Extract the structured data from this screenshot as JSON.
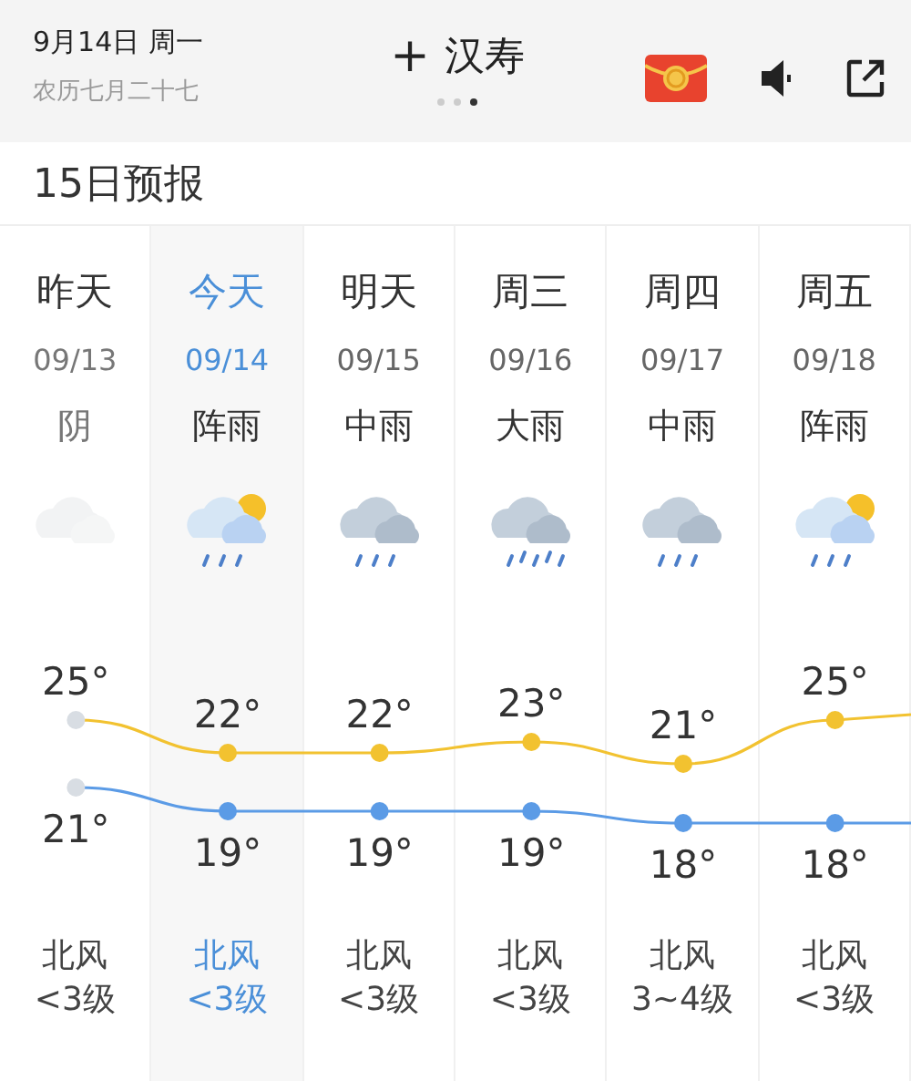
{
  "header": {
    "date": "9月14日 周一",
    "lunar": "农历七月二十七",
    "add_symbol": "+",
    "city": "汉寿",
    "pages": [
      {
        "selected": false
      },
      {
        "selected": false
      },
      {
        "selected": true
      }
    ]
  },
  "section_title": "15日预报",
  "days": [
    {
      "name": "昨天",
      "date": "09/13",
      "condition": "阴",
      "kind": "cloudy",
      "past": true,
      "selected": false,
      "high": "25°",
      "low": "21°",
      "wind": "北风",
      "wind_level": "<3级"
    },
    {
      "name": "今天",
      "date": "09/14",
      "condition": "阵雨",
      "kind": "shower",
      "past": false,
      "selected": true,
      "high": "22°",
      "low": "19°",
      "wind": "北风",
      "wind_level": "<3级"
    },
    {
      "name": "明天",
      "date": "09/15",
      "condition": "中雨",
      "kind": "rain",
      "past": false,
      "selected": false,
      "high": "22°",
      "low": "19°",
      "wind": "北风",
      "wind_level": "<3级"
    },
    {
      "name": "周三",
      "date": "09/16",
      "condition": "大雨",
      "kind": "heavy-rain",
      "past": false,
      "selected": false,
      "high": "23°",
      "low": "19°",
      "wind": "北风",
      "wind_level": "<3级"
    },
    {
      "name": "周四",
      "date": "09/17",
      "condition": "中雨",
      "kind": "rain",
      "past": false,
      "selected": false,
      "high": "21°",
      "low": "18°",
      "wind": "北风",
      "wind_level": "3~4级"
    },
    {
      "name": "周五",
      "date": "09/18",
      "condition": "阵雨",
      "kind": "shower",
      "past": false,
      "selected": false,
      "high": "25°",
      "low": "18°",
      "wind": "北风",
      "wind_level": "<3级"
    }
  ]
}
